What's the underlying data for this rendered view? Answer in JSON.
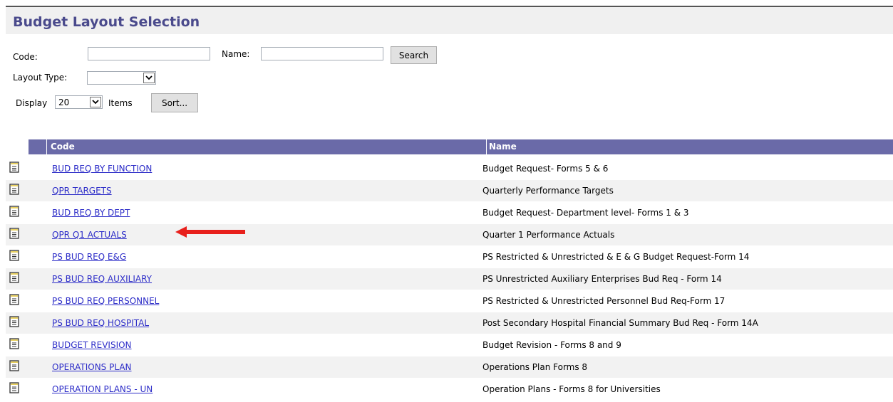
{
  "title": "Budget Layout Selection",
  "filters": {
    "code_label": "Code:",
    "code_value": "",
    "name_label": "Name:",
    "name_value": "",
    "search_button": "Search",
    "layout_type_label": "Layout Type:",
    "layout_type_value": "",
    "display_label": "Display",
    "display_value": "20",
    "items_label": "Items",
    "sort_button": "Sort..."
  },
  "table": {
    "columns": [
      "Code",
      "Name"
    ],
    "rows": [
      {
        "code": "BUD REQ BY FUNCTION",
        "name": "Budget Request- Forms 5 & 6"
      },
      {
        "code": "QPR TARGETS",
        "name": "Quarterly Performance Targets"
      },
      {
        "code": "BUD REQ BY DEPT",
        "name": "Budget Request- Department level- Forms 1 & 3"
      },
      {
        "code": "QPR Q1 ACTUALS",
        "name": "Quarter 1 Performance Actuals"
      },
      {
        "code": "PS BUD REQ E&G",
        "name": "PS Restricted & Unrestricted & E & G Budget Request-Form 14"
      },
      {
        "code": "PS BUD REQ AUXILIARY",
        "name": "PS Unrestricted Auxiliary Enterprises Bud Req - Form 14"
      },
      {
        "code": "PS BUD REQ PERSONNEL",
        "name": "PS Restricted & Unrestricted Personnel Bud Req-Form 17"
      },
      {
        "code": "PS BUD REQ HOSPITAL",
        "name": "Post Secondary Hospital Financial Summary Bud Req - Form 14A"
      },
      {
        "code": "BUDGET REVISION",
        "name": "Budget Revision - Forms 8 and 9"
      },
      {
        "code": "OPERATIONS PLAN",
        "name": "Operations Plan Forms 8"
      },
      {
        "code": "OPERATION PLANS - UN",
        "name": "Operation Plans - Forms 8 for Universities"
      }
    ]
  },
  "annotation": {
    "arrow_color": "#e8201c",
    "points_to": "QPR Q1 ACTUALS"
  },
  "colors": {
    "title": "#4a4a8c",
    "header_bg": "#6a6aa8",
    "link": "#2d2dc8"
  }
}
